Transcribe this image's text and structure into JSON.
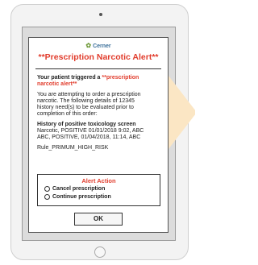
{
  "dialog": {
    "logo_text": "Cerner",
    "title": "**Prescription Narcotic Alert**",
    "trigger_prefix": "Your patient triggered a",
    "trigger_highlight": "**prescription",
    "trigger_highlight_2": "narcotic alert**",
    "message_line1": "You are attempting to order a prescription",
    "message_line2": "narcotic. The following details of 12345",
    "message_line3": "history need(s) to be evaluated prior to",
    "message_line4": "completion of this order:",
    "history_heading": "History of positive toxicology screen",
    "history_line1": "Narcotic, POSITIVE 01/01/2018 9:02, ABC",
    "history_line2": "ABC, POSITIVE, 01/04/2018, 11:14, ABC",
    "rule": "Rule_PRIMUM_HIGH_RISK",
    "actions_title": "Alert Action",
    "options": [
      "Cancel prescription",
      "Continue prescription"
    ],
    "ok_label": "OK"
  },
  "colors": {
    "alert_red": "#e13c2c",
    "arrow_fill": "#fbe6c4",
    "screen_bg": "#dcdcdc"
  }
}
